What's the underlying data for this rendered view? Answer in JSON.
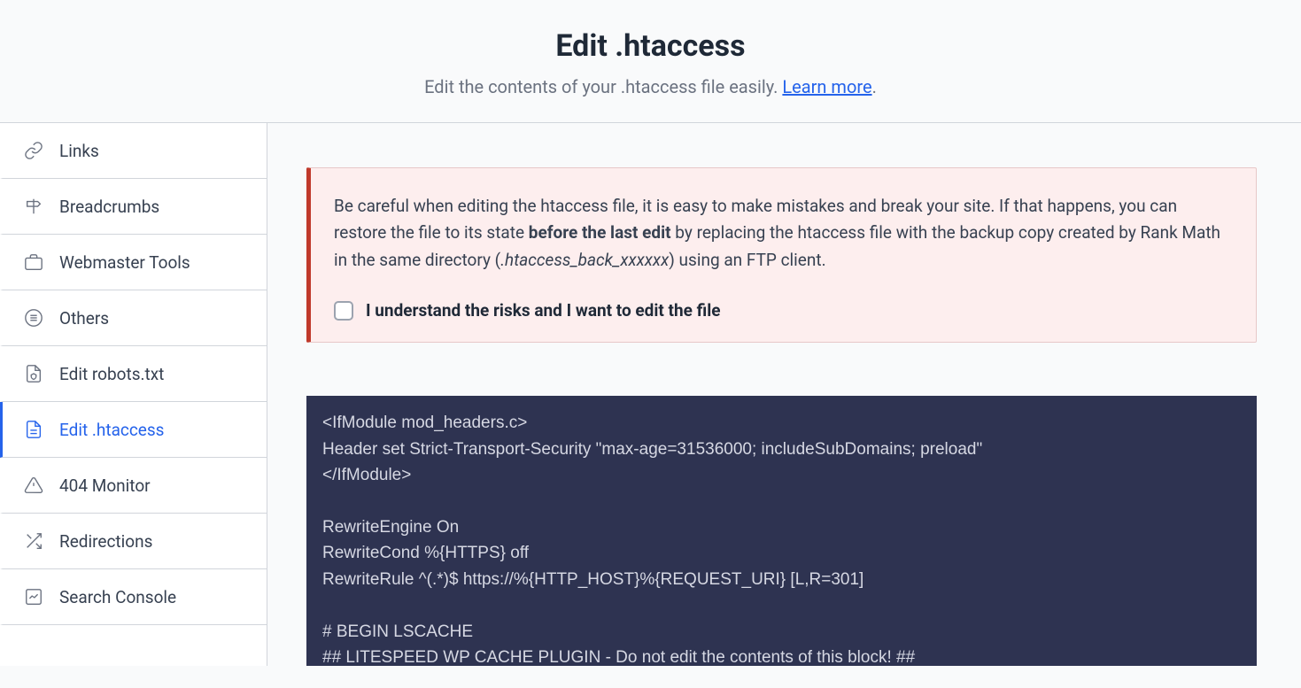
{
  "header": {
    "title": "Edit .htaccess",
    "subtitle_prefix": "Edit the contents of your .htaccess file easily. ",
    "learn_more": "Learn more",
    "subtitle_suffix": "."
  },
  "sidebar": {
    "items": [
      {
        "label": "Links",
        "icon": "links"
      },
      {
        "label": "Breadcrumbs",
        "icon": "signpost"
      },
      {
        "label": "Webmaster Tools",
        "icon": "briefcase"
      },
      {
        "label": "Others",
        "icon": "list-circle"
      },
      {
        "label": "Edit robots.txt",
        "icon": "file-shield"
      },
      {
        "label": "Edit .htaccess",
        "icon": "file-lines"
      },
      {
        "label": "404 Monitor",
        "icon": "warning"
      },
      {
        "label": "Redirections",
        "icon": "shuffle"
      },
      {
        "label": "Search Console",
        "icon": "chart"
      }
    ]
  },
  "warning": {
    "text_part1": "Be careful when editing the htaccess file, it is easy to make mistakes and break your site. If that happens, you can restore the file to its state ",
    "text_bold": "before the last edit",
    "text_part2": " by replacing the htaccess file with the backup copy created by Rank Math in the same directory (",
    "text_italic": ".htaccess_back_xxxxxx",
    "text_part3": ") using an FTP client.",
    "checkbox_label": "I understand the risks and I want to edit the file"
  },
  "editor": {
    "content": "<IfModule mod_headers.c>\nHeader set Strict-Transport-Security \"max-age=31536000; includeSubDomains; preload\"\n</IfModule>\n\nRewriteEngine On\nRewriteCond %{HTTPS} off\nRewriteRule ^(.*)$ https://%{HTTP_HOST}%{REQUEST_URI} [L,R=301]\n\n# BEGIN LSCACHE\n## LITESPEED WP CACHE PLUGIN - Do not edit the contents of this block! ##"
  }
}
